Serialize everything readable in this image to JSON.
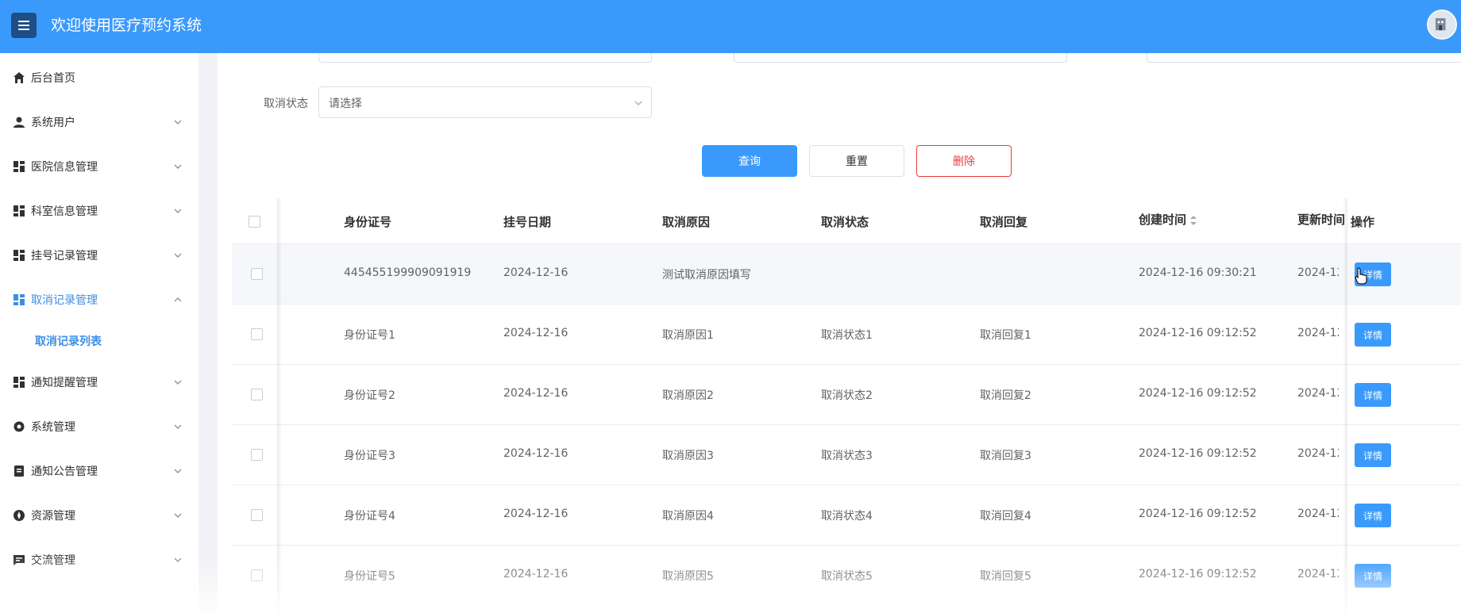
{
  "header": {
    "title": "欢迎使用医疗预约系统"
  },
  "sidebar": {
    "items": [
      {
        "label": "后台首页",
        "icon": "home-icon"
      },
      {
        "label": "系统用户",
        "icon": "user-icon"
      },
      {
        "label": "医院信息管理",
        "icon": "grid-icon"
      },
      {
        "label": "科室信息管理",
        "icon": "grid-icon"
      },
      {
        "label": "挂号记录管理",
        "icon": "grid-icon"
      },
      {
        "label": "取消记录管理",
        "icon": "grid-icon",
        "active": true
      },
      {
        "label": "通知提醒管理",
        "icon": "grid-icon"
      },
      {
        "label": "系统管理",
        "icon": "gear-icon"
      },
      {
        "label": "通知公告管理",
        "icon": "document-icon"
      },
      {
        "label": "资源管理",
        "icon": "compass-icon"
      },
      {
        "label": "交流管理",
        "icon": "chat-icon"
      }
    ],
    "active_sub_item": "取消记录列表"
  },
  "search": {
    "cancel_status_label": "取消状态",
    "cancel_status_placeholder": "请选择",
    "query_button": "查询",
    "reset_button": "重置",
    "delete_button": "删除"
  },
  "table": {
    "columns": [
      "身份证号",
      "挂号日期",
      "取消原因",
      "取消状态",
      "取消回复",
      "创建时间",
      "更新时间",
      "操作"
    ],
    "action_label": "详情",
    "rows": [
      {
        "id_number": "445455199909091919",
        "reg_date": "2024-12-16",
        "reason": "测试取消原因填写",
        "status": "",
        "reply": "",
        "created": "2024-12-16 09:30:21",
        "updated": "2024-12"
      },
      {
        "id_number": "身份证号1",
        "reg_date": "2024-12-16",
        "reason": "取消原因1",
        "status": "取消状态1",
        "reply": "取消回复1",
        "created": "2024-12-16 09:12:52",
        "updated": "2024-12"
      },
      {
        "id_number": "身份证号2",
        "reg_date": "2024-12-16",
        "reason": "取消原因2",
        "status": "取消状态2",
        "reply": "取消回复2",
        "created": "2024-12-16 09:12:52",
        "updated": "2024-12"
      },
      {
        "id_number": "身份证号3",
        "reg_date": "2024-12-16",
        "reason": "取消原因3",
        "status": "取消状态3",
        "reply": "取消回复3",
        "created": "2024-12-16 09:12:52",
        "updated": "2024-12"
      },
      {
        "id_number": "身份证号4",
        "reg_date": "2024-12-16",
        "reason": "取消原因4",
        "status": "取消状态4",
        "reply": "取消回复4",
        "created": "2024-12-16 09:12:52",
        "updated": "2024-12"
      },
      {
        "id_number": "身份证号5",
        "reg_date": "2024-12-16",
        "reason": "取消原因5",
        "status": "取消状态5",
        "reply": "取消回复5",
        "created": "2024-12-16 09:12:52",
        "updated": "2024-12"
      }
    ]
  },
  "colors": {
    "header_bg": "#3a9afc",
    "accent": "#3a8ee6",
    "danger": "#e43e3e"
  }
}
